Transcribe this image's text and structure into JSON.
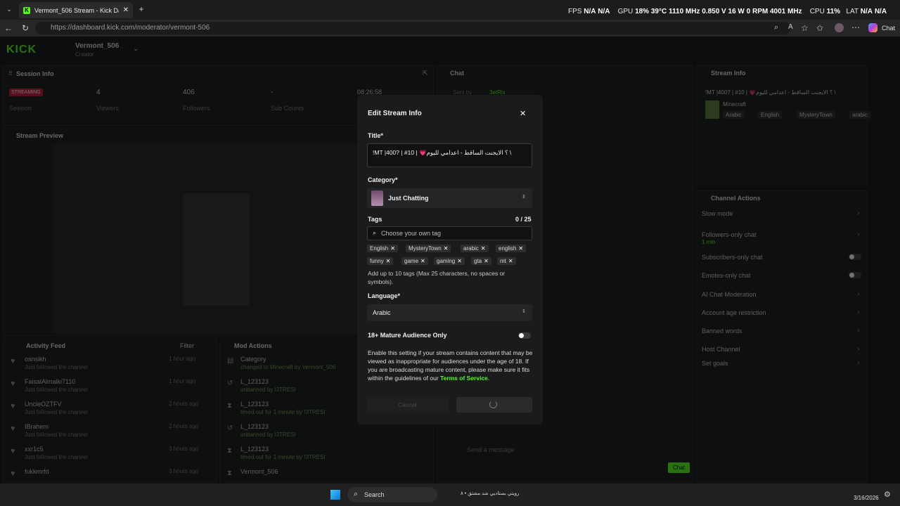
{
  "browser": {
    "tab_title": "Vermont_506 Stream - Kick Dashb",
    "url": "https://dashboard.kick.com/moderator/vermont-506",
    "copilot_label": "Chat",
    "perf": {
      "fps_label": "FPS",
      "fps_val1": "N/A",
      "fps_val2": "N/A",
      "gpu_label": "GPU",
      "gpu_usage": "18%",
      "gpu_temp": "39°C",
      "gpu_clock": "1110 MHz",
      "gpu_volt": "0.850 V",
      "gpu_power": "16 W",
      "gpu_fan": "0 RPM",
      "gpu_mem": "4001 MHz",
      "cpu_label": "CPU",
      "cpu_usage": "11%",
      "lat_label": "LAT",
      "lat_val1": "N/A",
      "lat_val2": "N/A"
    }
  },
  "header": {
    "logo": "KICK",
    "channel_name": "Vermont_506",
    "channel_role": "Creator"
  },
  "session": {
    "title": "Session Info",
    "status_badge": "STREAMING",
    "status_label": "Session",
    "viewers_value": "4",
    "viewers_label": "Viewers",
    "followers_value": "406",
    "followers_label": "Followers",
    "subs_value": "-",
    "subs_label": "Sub Counts",
    "duration": "08:26:58"
  },
  "preview": {
    "title": "Stream Preview"
  },
  "chat": {
    "title": "Chat",
    "pinned_prefix": "Sent by",
    "pinned_user": "3etRix",
    "input_placeholder": "Send a message",
    "send_label": "Chat"
  },
  "stream_info": {
    "title": "Stream Info",
    "stream_title": "!MT |400? | #10 | 💗؟ الايجنت الساقط - اعدامي لليوم \\",
    "category": "Minecraft",
    "tags": [
      "Arabic",
      "English",
      "MysteryTown",
      "arabic"
    ]
  },
  "channel_actions": {
    "title": "Channel Actions",
    "items": [
      {
        "label": "Slow mode",
        "sub": ""
      },
      {
        "label": "Followers-only chat",
        "sub": "1 min"
      },
      {
        "label": "Subscribers-only chat",
        "sub": ""
      },
      {
        "label": "Emotes-only chat",
        "sub": ""
      },
      {
        "label": "AI Chat Moderation",
        "sub": ""
      },
      {
        "label": "Account age restriction",
        "sub": ""
      },
      {
        "label": "Banned words",
        "sub": ""
      },
      {
        "label": "Host Channel",
        "sub": ""
      },
      {
        "label": "Set goals",
        "sub": ""
      }
    ]
  },
  "activity": {
    "title": "Activity Feed",
    "filter_label": "Filter",
    "items": [
      {
        "user": "osnsikh",
        "action": "Just followed the channel",
        "time": "1 hour ago"
      },
      {
        "user": "FaisalAlmalki7110",
        "action": "Just followed the channel",
        "time": "1 hour ago"
      },
      {
        "user": "UncleOZTFV",
        "action": "Just followed the channel",
        "time": "2 hours ago"
      },
      {
        "user": "IBrahem",
        "action": "Just followed the channel",
        "time": "2 hours ago"
      },
      {
        "user": "xxr1c5",
        "action": "Just followed the channel",
        "time": "3 hours ago"
      },
      {
        "user": "fukkmrfd",
        "action": "",
        "time": "3 hours ago"
      }
    ]
  },
  "mod_actions": {
    "title": "Mod Actions",
    "items": [
      {
        "user": "Category",
        "action": "changed to Minecraft by Vermont_506"
      },
      {
        "user": "L_123123",
        "action": "unbanned by I3TRESI"
      },
      {
        "user": "L_123123",
        "action": "timed out for 1 minute by I3TRESI"
      },
      {
        "user": "L_123123",
        "action": "unbanned by I3TRESI"
      },
      {
        "user": "L_123123",
        "action": "timed out for 1 minute by I3TRESI"
      },
      {
        "user": "Vermont_506",
        "action": ""
      }
    ]
  },
  "modal": {
    "heading": "Edit Stream Info",
    "title_label": "Title*",
    "title_value": "!MT |400? | #10 | 💗؟ الايجنت الساقط - اعدامي لليوم \\",
    "category_label": "Category*",
    "category_value": "Just Chatting",
    "tags_label": "Tags",
    "tags_count": "0 / 25",
    "tags_placeholder": "Choose your own tag",
    "tags": [
      "English",
      "MysteryTown",
      "arabic",
      "english",
      "funny",
      "game",
      "gaming",
      "gta",
      "mt"
    ],
    "tags_help": "Add up to 10 tags (Max 25 characters, no spaces or symbols).",
    "language_label": "Language*",
    "language_value": "Arabic",
    "mature_label": "18+ Mature Audience Only",
    "mature_text": "Enable this setting if your stream contains content that may be viewed as inappropriate for audiences under the age of 18. If you are broadcasting mature content, please make sure it fits within the guidelines of our",
    "tos_link": "Terms of Service",
    "cancel_label": "Cancel"
  },
  "taskbar": {
    "search_placeholder": "Search",
    "date": "3/16/2026",
    "notification_text": "رويتي بستاديي شد مشتق • ٨"
  },
  "colors": {
    "accent": "#53fc18",
    "streaming": "#c8102e",
    "modal_bg": "#1a1b1c"
  }
}
